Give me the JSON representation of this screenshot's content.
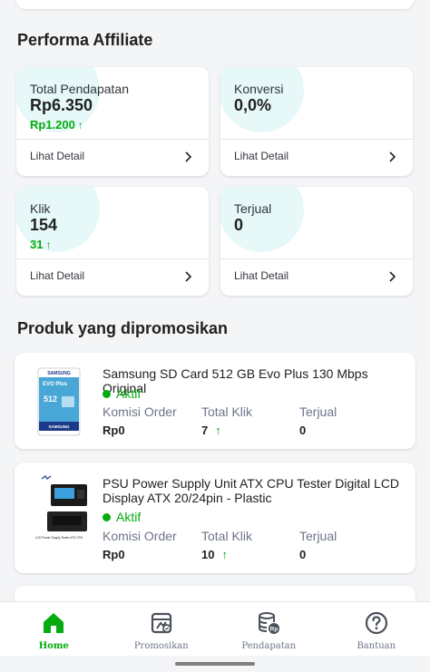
{
  "performance": {
    "title": "Performa Affiliate",
    "cards": [
      {
        "label": "Total Pendapatan",
        "value": "Rp6.350",
        "delta": "Rp1.200",
        "delta_arrow": "↑",
        "detail": "Lihat Detail"
      },
      {
        "label": "Konversi",
        "value": "0,0%",
        "delta": "",
        "delta_arrow": "",
        "detail": "Lihat Detail"
      },
      {
        "label": "Klik",
        "value": "154",
        "delta": "31",
        "delta_arrow": "↑",
        "detail": "Lihat Detail"
      },
      {
        "label": "Terjual",
        "value": "0",
        "delta": "",
        "delta_arrow": "",
        "detail": "Lihat Detail"
      }
    ]
  },
  "products": {
    "title": "Produk yang dipromosikan",
    "items": [
      {
        "name": "Samsung SD Card 512 GB Evo Plus 130 Mbps Original",
        "status": "Aktif",
        "thumb_brand": "SAMSUNG",
        "thumb_line": "EVO Plus",
        "thumb_capacity": "512",
        "metrics": [
          {
            "label": "Komisi Order",
            "value": "Rp0"
          },
          {
            "label": "Total Klik",
            "value": "7",
            "arrow": "↑"
          },
          {
            "label": "Terjual",
            "value": "0"
          }
        ]
      },
      {
        "name": "PSU Power Supply Unit ATX CPU Tester Digital LCD Display ATX 20/24pin - Plastic",
        "status": "Aktif",
        "thumb_caption": "LCD Power Supply Tester ATX CPU",
        "metrics": [
          {
            "label": "Komisi Order",
            "value": "Rp0"
          },
          {
            "label": "Total Klik",
            "value": "10",
            "arrow": "↑"
          },
          {
            "label": "Terjual",
            "value": "0"
          }
        ]
      }
    ]
  },
  "nav": {
    "items": [
      {
        "label": "Home",
        "icon": "home-icon",
        "active": true
      },
      {
        "label": "Promosikan",
        "icon": "promote-icon",
        "active": false
      },
      {
        "label": "Pendapatan",
        "icon": "coins-icon",
        "active": false
      },
      {
        "label": "Bantuan",
        "icon": "help-icon",
        "active": false
      }
    ]
  },
  "colors": {
    "accent": "#03ac0e",
    "blob": "#e6f8f8",
    "muted": "#6d7588"
  }
}
